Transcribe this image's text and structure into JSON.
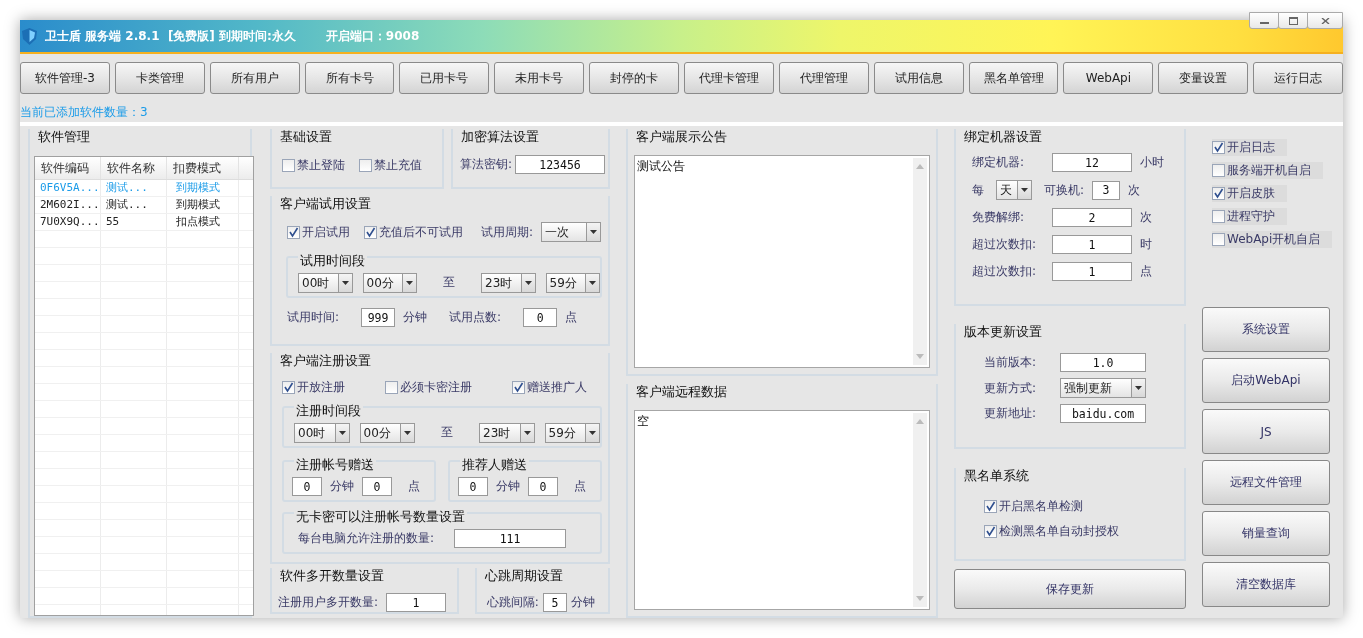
{
  "window": {
    "title": "卫士盾 服务端 2.8.1  [免费版] 到期时间:永久",
    "port": "开启端口：9008"
  },
  "toolbar": [
    "软件管理-3",
    "卡类管理",
    "所有用户",
    "所有卡号",
    "已用卡号",
    "未用卡号",
    "封停的卡",
    "代理卡管理",
    "代理管理",
    "试用信息",
    "黑名单管理",
    "WebApi",
    "变量设置",
    "运行日志"
  ],
  "software_count": "当前已添加软件数量：3",
  "software_panel": {
    "title": "软件管理",
    "columns": [
      "软件编码",
      "软件名称",
      "扣费模式"
    ],
    "rows": [
      {
        "cells": [
          "0F6V5A...",
          "测试...",
          "到期模式"
        ],
        "selected": true
      },
      {
        "cells": [
          "2M602I...",
          "测试...",
          "到期模式"
        ],
        "selected": false
      },
      {
        "cells": [
          "7U0X9Q...",
          "55",
          "扣点模式"
        ],
        "selected": false
      }
    ]
  },
  "basic": {
    "title": "基础设置",
    "options": [
      {
        "label": "禁止登陆",
        "checked": false
      },
      {
        "label": "禁止充值",
        "checked": false
      }
    ]
  },
  "encryption": {
    "title": "加密算法设置",
    "label": "算法密钥:",
    "value": "123456"
  },
  "trial": {
    "title": "客户端试用设置",
    "options": [
      {
        "label": "开启试用",
        "checked": true
      },
      {
        "label": "充值后不可试用",
        "checked": true
      }
    ],
    "period_label": "试用周期:",
    "period": "一次",
    "range": {
      "title": "试用时间段",
      "from_hour": "00时",
      "from_minute": "00分",
      "to": "至",
      "to_hour": "23时",
      "to_minute": "59分"
    },
    "time_label": "试用时间:",
    "time": "999",
    "time_unit": "分钟",
    "points_label": "试用点数:",
    "points": "0",
    "points_unit": "点"
  },
  "register": {
    "title": "客户端注册设置",
    "options": [
      {
        "label": "开放注册",
        "checked": true
      },
      {
        "label": "必须卡密注册",
        "checked": false
      },
      {
        "label": "赠送推广人",
        "checked": true
      }
    ],
    "range": {
      "title": "注册时间段",
      "from_hour": "00时",
      "from_minute": "00分",
      "to": "至",
      "to_hour": "23时",
      "to_minute": "59分"
    },
    "gifts": [
      {
        "title": "注册帐号赠送",
        "minutes": "0",
        "minutes_unit": "分钟",
        "points": "0",
        "points_unit": "点"
      },
      {
        "title": "推荐人赠送",
        "minutes": "0",
        "minutes_unit": "分钟",
        "points": "0",
        "points_unit": "点"
      }
    ],
    "limit": {
      "title": "无卡密可以注册帐号数量设置",
      "label": "每台电脑允许注册的数量:",
      "value": "111"
    }
  },
  "multi_open": {
    "title": "软件多开数量设置",
    "label": "注册用户多开数量:",
    "value": "1"
  },
  "heartbeat": {
    "title": "心跳周期设置",
    "label": "心跳间隔:",
    "value": "5",
    "unit": "分钟"
  },
  "notice": {
    "title": "客户端展示公告",
    "text": "测试公告"
  },
  "remote_data": {
    "title": "客户端远程数据",
    "text": "空"
  },
  "binding": {
    "title": "绑定机器设置",
    "rows": [
      {
        "kind": "field",
        "label": "绑定机器:",
        "value": "12",
        "unit": "小时"
      },
      {
        "kind": "period",
        "label": "每",
        "period": "天",
        "sub_label": "可换机:",
        "value": "3",
        "unit": "次"
      },
      {
        "kind": "field",
        "label": "免费解绑:",
        "value": "2",
        "unit": "次"
      },
      {
        "kind": "field",
        "label": "超过次数扣:",
        "value": "1",
        "unit": "时"
      },
      {
        "kind": "field",
        "label": "超过次数扣:",
        "value": "1",
        "unit": "点"
      }
    ]
  },
  "version": {
    "title": "版本更新设置",
    "rows": [
      {
        "kind": "field",
        "label": "当前版本:",
        "value": "1.0"
      },
      {
        "kind": "dropdown",
        "label": "更新方式:",
        "value": "强制更新"
      },
      {
        "kind": "field",
        "label": "更新地址:",
        "value": "baidu.com"
      }
    ]
  },
  "blacklist": {
    "title": "黑名单系统",
    "options": [
      {
        "label": "开启黑名单检测",
        "checked": true
      },
      {
        "label": "检测黑名单自动封授权",
        "checked": true
      }
    ]
  },
  "save_button": "保存更新",
  "switches": [
    {
      "label": "开启日志",
      "checked": true
    },
    {
      "label": "服务端开机自启",
      "checked": false
    },
    {
      "label": "开启皮肤",
      "checked": true
    },
    {
      "label": "进程守护",
      "checked": false
    },
    {
      "label": "WebApi开机自启",
      "checked": false
    }
  ],
  "actions": [
    "系统设置",
    "启动WebApi",
    "JS",
    "远程文件管理",
    "销量查询",
    "清空数据库"
  ]
}
